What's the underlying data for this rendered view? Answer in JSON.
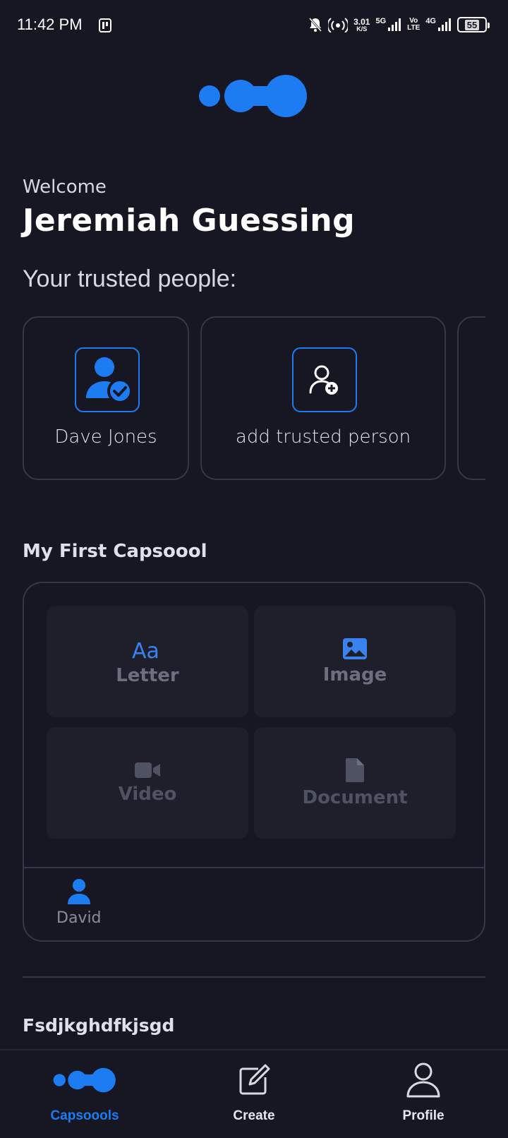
{
  "status_bar": {
    "time": "11:42 PM",
    "speed_value": "3.01",
    "speed_unit": "K/S",
    "net1": "5G",
    "volte_top": "Vo",
    "volte_bottom": "LTE",
    "net2": "4G",
    "battery": "55"
  },
  "welcome": {
    "label": "Welcome",
    "name": "Jeremiah Guessing"
  },
  "trusted": {
    "title": "Your trusted people:",
    "people": [
      {
        "name": "Dave Jones",
        "icon": "verified-user-icon"
      }
    ],
    "add_label": "add trusted person"
  },
  "capsule": {
    "title": "My First Capsoool",
    "tiles": [
      {
        "label": "Letter",
        "icon": "text-letter-icon"
      },
      {
        "label": "Image",
        "icon": "image-icon"
      },
      {
        "label": "Video",
        "icon": "video-camera-icon"
      },
      {
        "label": "Document",
        "icon": "document-icon"
      }
    ],
    "recipient": "David"
  },
  "next_capsule": {
    "title": "Fsdjkghdfkjsgd"
  },
  "nav": {
    "capsools": "Capsoools",
    "create": "Create",
    "profile": "Profile"
  },
  "colors": {
    "background": "#161722",
    "accent": "#1e7cf2",
    "card_border": "#34374a",
    "tile_bg": "#1e1f2b"
  }
}
